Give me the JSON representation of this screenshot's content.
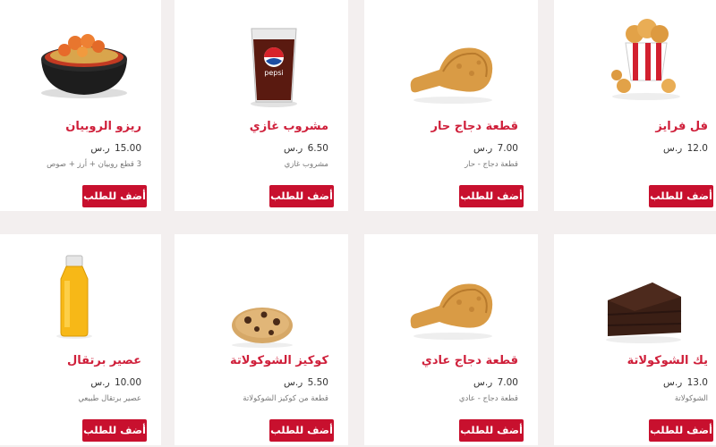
{
  "products": [
    {
      "name": "ريزو الروبيان",
      "price": "15.00",
      "currency": "ر.س",
      "desc": "3 قطع روبيان + أرز + صوص",
      "button": "أضف للطلب",
      "icon": "rizo-shrimp-bowl-icon"
    },
    {
      "name": "مشروب غازي",
      "price": "6.50",
      "currency": "ر.س",
      "desc": "مشروب غازي",
      "button": "أضف للطلب",
      "icon": "pepsi-cup-icon"
    },
    {
      "name": "قطعة دجاج حار",
      "price": "7.00",
      "currency": "ر.س",
      "desc": "قطعة دجاج - حار",
      "button": "أضف للطلب",
      "icon": "fried-chicken-drumstick-icon"
    },
    {
      "name": "فل فرايز",
      "price": "12.0",
      "currency": "ر.س",
      "desc": "",
      "button": "أضف للطلب",
      "icon": "waffle-fries-icon"
    },
    {
      "name": "عصير برتقال",
      "price": "10.00",
      "currency": "ر.س",
      "desc": "عصير برتقال طبيعي",
      "button": "أضف للطلب",
      "icon": "orange-juice-bottle-icon"
    },
    {
      "name": "كوكيز الشوكولاتة",
      "price": "5.50",
      "currency": "ر.س",
      "desc": "قطعة من كوكيز الشوكولاتة",
      "button": "أضف للطلب",
      "icon": "chocolate-cookie-icon"
    },
    {
      "name": "قطعة دجاج عادي",
      "price": "7.00",
      "currency": "ر.س",
      "desc": "قطعة دجاج - عادي",
      "button": "أضف للطلب",
      "icon": "fried-chicken-drumstick-icon"
    },
    {
      "name": "يك الشوكولاتة",
      "price": "13.0",
      "currency": "ر.س",
      "desc": "الشوكولاتة",
      "button": "أضف للطلب",
      "icon": "chocolate-cake-slice-icon"
    }
  ]
}
